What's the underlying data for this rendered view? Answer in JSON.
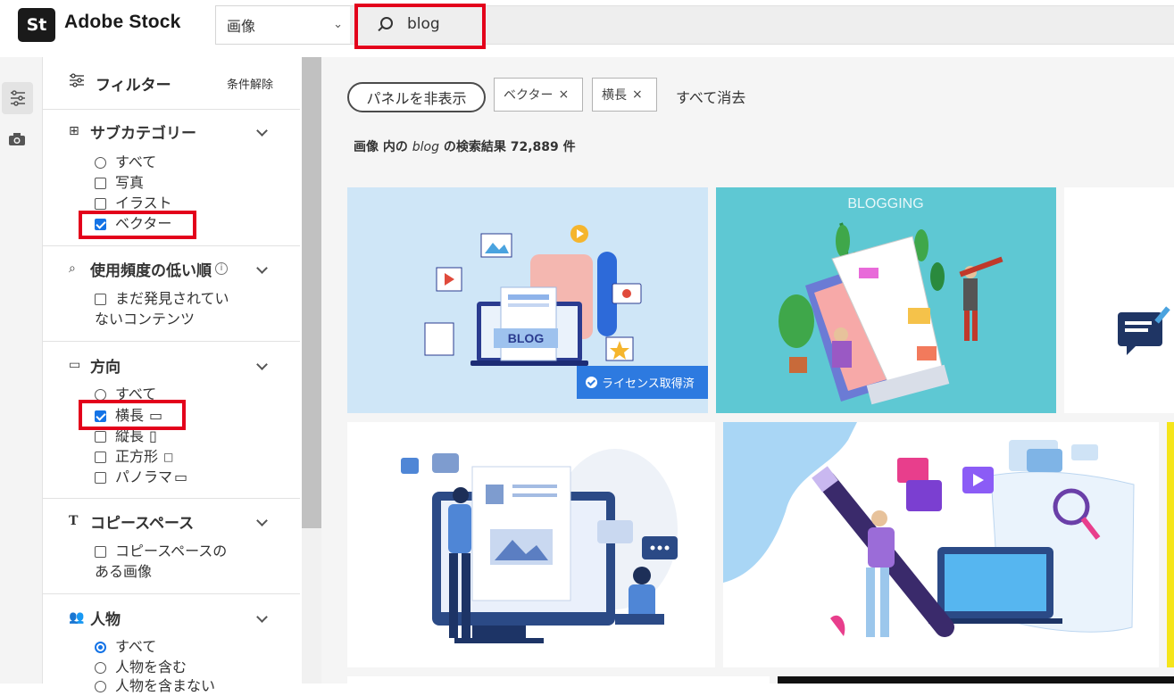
{
  "header": {
    "logo_mark": "St",
    "logo_text": "Adobe Stock",
    "type_select": "画像",
    "search_value": "blog"
  },
  "panel": {
    "title": "フィルター",
    "clear": "条件解除",
    "subcategory": {
      "title": "サブカテゴリー",
      "options": [
        "すべて",
        "写真",
        "イラスト",
        "ベクター"
      ]
    },
    "low_usage": {
      "title": "使用頻度の低い順",
      "option_line1": "まだ発見されてい",
      "option_line2": "ないコンテンツ"
    },
    "orientation": {
      "title": "方向",
      "options": [
        "すべて",
        "横長",
        "縦長",
        "正方形",
        "パノラマ"
      ]
    },
    "copy_space": {
      "title": "コピースペース",
      "option_line1": "コピースペースの",
      "option_line2": "ある画像"
    },
    "people": {
      "title": "人物",
      "options": [
        "すべて",
        "人物を含む",
        "人物を含まない"
      ]
    }
  },
  "content": {
    "hide_panel": "パネルを非表示",
    "chips": [
      "ベクター",
      "横長"
    ],
    "chip_close": "×",
    "clear_all": "すべて消去",
    "results_prefix": "画像 内の",
    "results_query": "blog",
    "results_suffix": "の検索結果 72,889 件",
    "license_badge": "ライセンス取得済",
    "tiles": [
      {
        "title": "BLOG",
        "bg": "#cfe6f7"
      },
      {
        "title": "BLOGGING",
        "bg": "#5ec8d3"
      }
    ]
  },
  "colors": {
    "accent": "#1473e6",
    "highlight": "#e3001b",
    "badge": "#2d7ae0"
  }
}
